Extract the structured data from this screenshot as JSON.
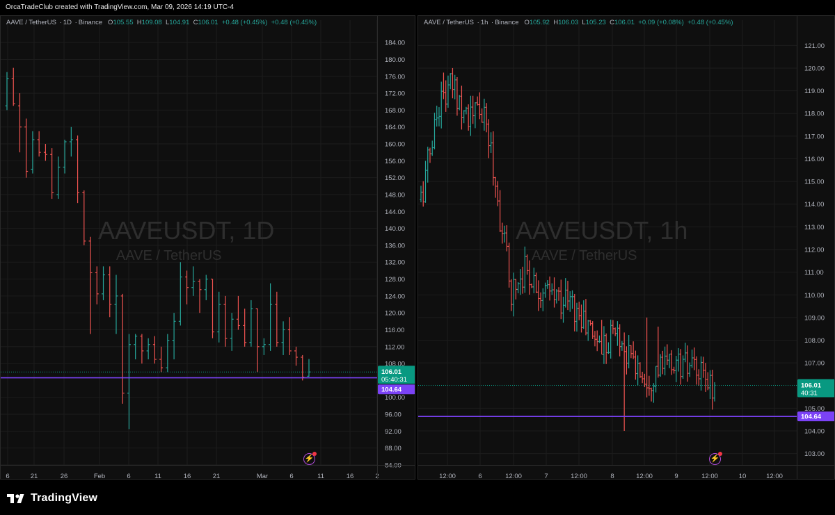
{
  "header": {
    "title": "OrcaTradeClub created with TradingView.com, Mar 09, 2026 14:19 UTC-4"
  },
  "footer": {
    "logo_text": "TradingView"
  },
  "colors": {
    "up": "#26a69a",
    "down": "#ef5350",
    "level": "#7b42f6",
    "price_tag": "#089981",
    "background": "#0f0f0f",
    "grid": "#1e1e1e"
  },
  "chart_data": [
    {
      "type": "candlestick",
      "symbol": "AAVE / TetherUS",
      "interval": "1D",
      "exchange": "Binance",
      "ohlc_label": {
        "o_key": "O",
        "o": "105.55",
        "h_key": "H",
        "h": "109.08",
        "l_key": "L",
        "l": "104.91",
        "c_key": "C",
        "c": "106.01",
        "change1": "+0.48 (+0.45%)",
        "change2": "+0.48 (+0.45%)"
      },
      "watermark": {
        "line1": "AAVEUSDT, 1D",
        "line2": "AAVE / TetherUS"
      },
      "ylim": [
        84,
        186
      ],
      "y_ticks": [
        "184.00",
        "180.00",
        "176.00",
        "172.00",
        "168.00",
        "164.00",
        "160.00",
        "156.00",
        "152.00",
        "148.00",
        "144.00",
        "140.00",
        "136.00",
        "132.00",
        "128.00",
        "124.00",
        "120.00",
        "116.00",
        "112.00",
        "108.00",
        "100.00",
        "96.00",
        "92.00",
        "88.00",
        "84.00"
      ],
      "x_ticks": [
        "6",
        "21",
        "26",
        "Feb",
        "6",
        "11",
        "16",
        "21",
        "Mar",
        "6",
        "11",
        "16",
        "2"
      ],
      "last_price": {
        "value": 106.01,
        "label": "106.01",
        "countdown": "05:40:31"
      },
      "level_line": {
        "value": 104.64,
        "label": "104.64"
      },
      "candles": [
        {
          "o": 169.0,
          "h": 177.0,
          "l": 168.0,
          "c": 175.5
        },
        {
          "o": 175.5,
          "h": 178.0,
          "l": 169.0,
          "c": 169.5
        },
        {
          "o": 169.0,
          "h": 172.0,
          "l": 158.0,
          "c": 164.0
        },
        {
          "o": 164.0,
          "h": 166.0,
          "l": 152.0,
          "c": 153.5
        },
        {
          "o": 154.0,
          "h": 163.0,
          "l": 153.0,
          "c": 161.0
        },
        {
          "o": 161.0,
          "h": 163.0,
          "l": 157.0,
          "c": 158.0
        },
        {
          "o": 158.0,
          "h": 160.0,
          "l": 156.0,
          "c": 157.5
        },
        {
          "o": 157.5,
          "h": 159.0,
          "l": 147.0,
          "c": 148.5
        },
        {
          "o": 148.0,
          "h": 157.0,
          "l": 147.0,
          "c": 154.5
        },
        {
          "o": 154.5,
          "h": 161.0,
          "l": 153.0,
          "c": 160.5
        },
        {
          "o": 160.5,
          "h": 164.0,
          "l": 157.0,
          "c": 161.0
        },
        {
          "o": 161.0,
          "h": 162.0,
          "l": 146.0,
          "c": 148.5
        },
        {
          "o": 148.5,
          "h": 149.0,
          "l": 136.0,
          "c": 137.0
        },
        {
          "o": 137.0,
          "h": 138.0,
          "l": 115.0,
          "c": 129.5
        },
        {
          "o": 129.5,
          "h": 131.0,
          "l": 122.0,
          "c": 124.5
        },
        {
          "o": 124.5,
          "h": 131.0,
          "l": 123.0,
          "c": 129.0
        },
        {
          "o": 129.0,
          "h": 131.0,
          "l": 119.0,
          "c": 122.0
        },
        {
          "o": 122.0,
          "h": 129.0,
          "l": 115.0,
          "c": 124.0
        },
        {
          "o": 124.0,
          "h": 124.5,
          "l": 98.5,
          "c": 101.0
        },
        {
          "o": 101.0,
          "h": 115.0,
          "l": 92.5,
          "c": 112.5
        },
        {
          "o": 112.5,
          "h": 115.0,
          "l": 109.0,
          "c": 114.5
        },
        {
          "o": 114.5,
          "h": 115.0,
          "l": 108.0,
          "c": 111.0
        },
        {
          "o": 111.0,
          "h": 114.0,
          "l": 109.0,
          "c": 112.5
        },
        {
          "o": 112.5,
          "h": 114.5,
          "l": 108.0,
          "c": 109.0
        },
        {
          "o": 109.0,
          "h": 112.0,
          "l": 106.0,
          "c": 107.0
        },
        {
          "o": 107.0,
          "h": 115.0,
          "l": 106.0,
          "c": 113.5
        },
        {
          "o": 113.5,
          "h": 120.0,
          "l": 109.0,
          "c": 118.0
        },
        {
          "o": 118.0,
          "h": 132.0,
          "l": 117.0,
          "c": 128.5
        },
        {
          "o": 128.5,
          "h": 130.0,
          "l": 122.0,
          "c": 126.0
        },
        {
          "o": 126.0,
          "h": 131.0,
          "l": 124.0,
          "c": 127.5
        },
        {
          "o": 127.5,
          "h": 128.0,
          "l": 120.0,
          "c": 125.5
        },
        {
          "o": 125.5,
          "h": 129.0,
          "l": 123.0,
          "c": 128.0
        },
        {
          "o": 128.0,
          "h": 128.0,
          "l": 114.0,
          "c": 115.5
        },
        {
          "o": 115.5,
          "h": 125.0,
          "l": 113.0,
          "c": 122.0
        },
        {
          "o": 122.0,
          "h": 124.0,
          "l": 112.0,
          "c": 114.0
        },
        {
          "o": 114.0,
          "h": 120.0,
          "l": 111.0,
          "c": 118.5
        },
        {
          "o": 118.5,
          "h": 124.0,
          "l": 116.0,
          "c": 117.0
        },
        {
          "o": 117.0,
          "h": 121.0,
          "l": 112.0,
          "c": 113.0
        },
        {
          "o": 113.0,
          "h": 123.0,
          "l": 112.0,
          "c": 121.0
        },
        {
          "o": 121.0,
          "h": 121.0,
          "l": 106.0,
          "c": 112.0
        },
        {
          "o": 112.0,
          "h": 114.0,
          "l": 110.0,
          "c": 112.5
        },
        {
          "o": 112.5,
          "h": 127.0,
          "l": 111.0,
          "c": 122.0
        },
        {
          "o": 122.0,
          "h": 125.0,
          "l": 112.0,
          "c": 113.0
        },
        {
          "o": 113.0,
          "h": 118.0,
          "l": 110.0,
          "c": 116.0
        },
        {
          "o": 116.0,
          "h": 119.0,
          "l": 110.0,
          "c": 111.0
        },
        {
          "o": 111.0,
          "h": 112.0,
          "l": 107.5,
          "c": 109.5
        },
        {
          "o": 109.5,
          "h": 110.0,
          "l": 104.0,
          "c": 104.8
        },
        {
          "o": 105.0,
          "h": 109.08,
          "l": 104.91,
          "c": 106.01
        }
      ]
    },
    {
      "type": "candlestick",
      "symbol": "AAVE / TetherUS",
      "interval": "1h",
      "exchange": "Binance",
      "ohlc_label": {
        "o_key": "O",
        "o": "105.92",
        "h_key": "H",
        "h": "106.03",
        "l_key": "L",
        "l": "105.23",
        "c_key": "C",
        "c": "106.01",
        "change1": "+0.09 (+0.08%)",
        "change2": "+0.48 (+0.45%)"
      },
      "watermark": {
        "line1": "AAVEUSDT, 1h",
        "line2": "AAVE / TetherUS"
      },
      "ylim": [
        102.5,
        121.5
      ],
      "y_ticks": [
        "121.00",
        "120.00",
        "119.00",
        "118.00",
        "117.00",
        "116.00",
        "115.00",
        "114.00",
        "113.00",
        "112.00",
        "111.00",
        "110.00",
        "109.00",
        "108.00",
        "107.00",
        "105.00",
        "104.00",
        "103.00"
      ],
      "x_ticks": [
        "12:00",
        "6",
        "12:00",
        "7",
        "12:00",
        "8",
        "12:00",
        "9",
        "12:00",
        "10",
        "12:00"
      ],
      "last_price": {
        "value": 106.01,
        "label": "106.01",
        "countdown": "40:31"
      },
      "level_line": {
        "value": 104.64,
        "label": "104.64"
      }
    }
  ]
}
